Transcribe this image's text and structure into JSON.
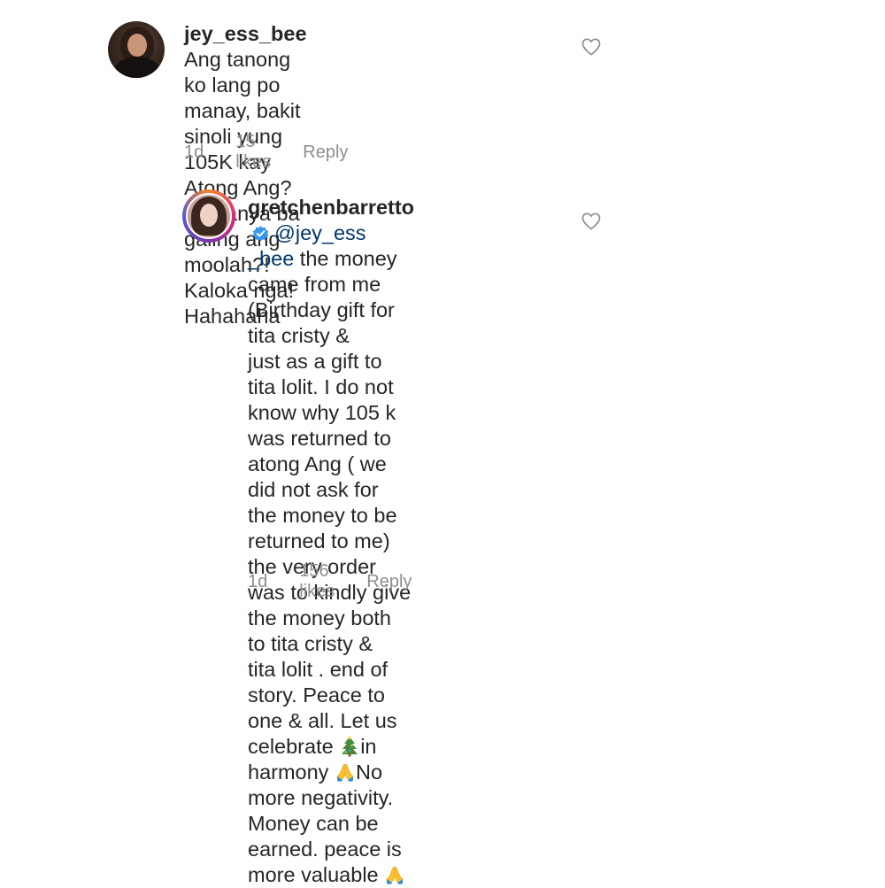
{
  "comments": [
    {
      "username": "jey_ess_bee",
      "lines": [
        " Ang tanong ko lang po",
        "manay, bakit sinoli yung 105K kay",
        "Atong Ang? Sa kanya ba galing ang",
        "moolah?! Kaloka nga! Hahahaha"
      ],
      "time": "1d",
      "likes": "15 likes",
      "reply": "Reply",
      "avatar_icon": "user-avatar",
      "heart_icon": "heart-outline-icon"
    },
    {
      "username": "gretchenbarretto",
      "verified": true,
      "mention_part1": "@jey_ess",
      "mention_part2": "_bee",
      "lines": [
        " the money came from me",
        "(Birthday gift for tita cristy &",
        "just as a gift to tita lolit. I do not",
        "know why 105 k was returned to",
        "atong Ang ( we did not ask for",
        "the money to be returned to me)",
        "the very order was to kindly give",
        "the money both to tita cristy &",
        "tita lolit . end of story. Peace to",
        "one & all. Let us celebrate ",
        "in",
        "harmony ",
        "No more negativity.",
        "Money can be earned. peace is",
        "more valuable "
      ],
      "time": "1d",
      "likes": "156 likes",
      "reply": "Reply",
      "avatar_icon": "user-avatar-story-ring",
      "heart_icon": "heart-outline-icon",
      "emojis": [
        "christmas-tree-icon",
        "folded-hands-icon",
        "folded-hands-icon"
      ]
    }
  ],
  "colors": {
    "text": "#262626",
    "meta": "#8e8e8e",
    "mention": "#00376b",
    "verified": "#3897f0"
  }
}
